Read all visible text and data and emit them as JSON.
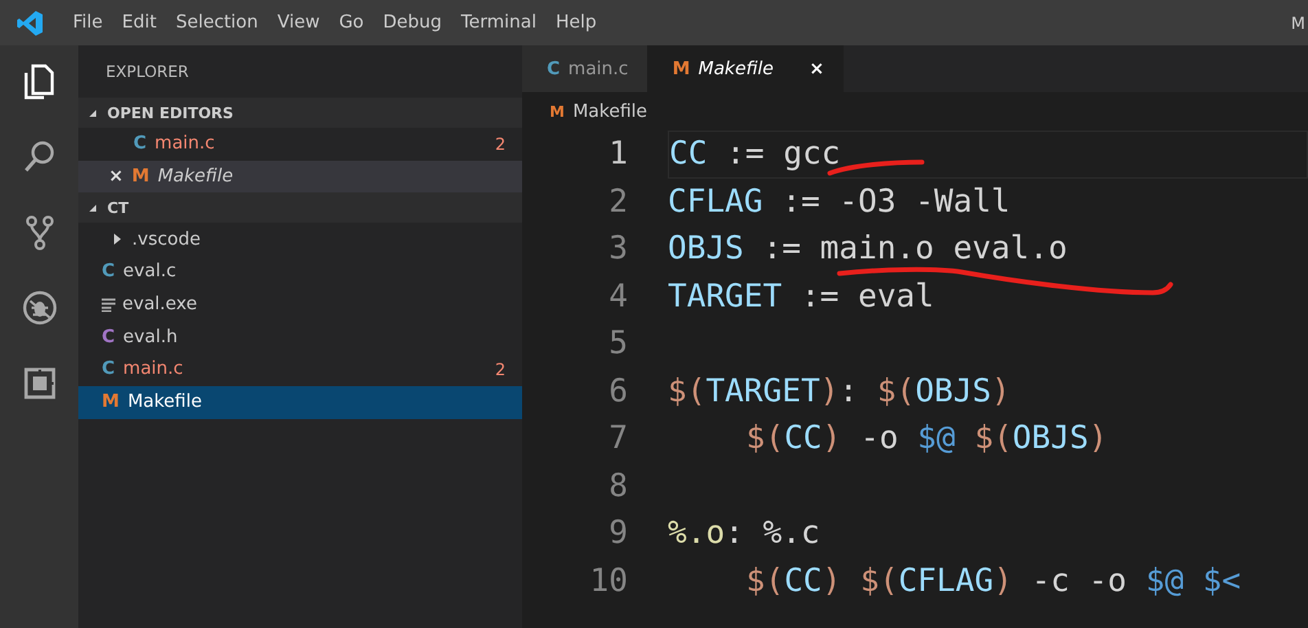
{
  "menu": {
    "items": [
      "File",
      "Edit",
      "Selection",
      "View",
      "Go",
      "Debug",
      "Terminal",
      "Help"
    ],
    "title": "M"
  },
  "activity_bar": {
    "items": [
      {
        "kind": "files",
        "selected": true
      },
      {
        "kind": "search",
        "selected": false
      },
      {
        "kind": "source-control",
        "selected": false
      },
      {
        "kind": "debug",
        "selected": false
      },
      {
        "kind": "extensions",
        "selected": false
      }
    ]
  },
  "sidebar": {
    "title": "EXPLORER",
    "sections": [
      {
        "title": "OPEN EDITORS",
        "expanded": true,
        "items": [
          {
            "kind": "c",
            "icon": "C",
            "name": "main.c",
            "errors": true,
            "badge": "2",
            "preview": false,
            "selected": false
          },
          {
            "kind": "make",
            "icon": "M",
            "name": "Makefile",
            "errors": false,
            "close": "×",
            "preview": true,
            "selected": true
          }
        ]
      },
      {
        "title": "CT",
        "expanded": true,
        "items": [
          {
            "kind": "folder",
            "name": ".vscode",
            "expanded": false,
            "errors": false,
            "selected": false
          },
          {
            "kind": "c",
            "icon": "C",
            "name": "eval.c",
            "errors": false,
            "selected": false
          },
          {
            "kind": "binary",
            "name": "eval.exe",
            "errors": false,
            "selected": false
          },
          {
            "kind": "h",
            "icon": "C",
            "name": "eval.h",
            "errors": false,
            "selected": false
          },
          {
            "kind": "c",
            "icon": "C",
            "name": "main.c",
            "errors": true,
            "badge": "2",
            "selected": false
          },
          {
            "kind": "make",
            "icon": "M",
            "name": "Makefile",
            "errors": false,
            "selected": true
          }
        ]
      }
    ]
  },
  "editor": {
    "tabs": [
      {
        "kind": "c",
        "icon": "C",
        "label": "main.c",
        "preview": false,
        "selected": false
      },
      {
        "kind": "make",
        "icon": "M",
        "label": "Makefile",
        "preview": true,
        "selected": true,
        "close": "×"
      }
    ],
    "breadcrumb": {
      "kind": "make",
      "icon": "M",
      "label": "Makefile"
    },
    "lines": [
      {
        "number": "1",
        "current": true,
        "indented": false,
        "tokens": [
          {
            "kind": "var",
            "text": "CC"
          },
          {
            "kind": "plain",
            "text": " := gcc"
          }
        ]
      },
      {
        "number": "2",
        "current": false,
        "indented": false,
        "tokens": [
          {
            "kind": "var",
            "text": "CFLAG"
          },
          {
            "kind": "plain",
            "text": " := -O3 -Wall"
          }
        ]
      },
      {
        "number": "3",
        "current": false,
        "indented": false,
        "tokens": [
          {
            "kind": "var",
            "text": "OBJS"
          },
          {
            "kind": "plain",
            "text": " := main.o eval.o"
          }
        ]
      },
      {
        "number": "4",
        "current": false,
        "indented": false,
        "tokens": [
          {
            "kind": "var",
            "text": "TARGET"
          },
          {
            "kind": "plain",
            "text": " := eval"
          }
        ]
      },
      {
        "number": "5",
        "current": false
      },
      {
        "number": "6",
        "current": false,
        "indented": false,
        "tokens": [
          {
            "kind": "paren",
            "text": "$("
          },
          {
            "kind": "var",
            "text": "TARGET"
          },
          {
            "kind": "paren",
            "text": ")"
          },
          {
            "kind": "plain",
            "text": ": "
          },
          {
            "kind": "paren",
            "text": "$("
          },
          {
            "kind": "var",
            "text": "OBJS"
          },
          {
            "kind": "paren",
            "text": ")"
          }
        ]
      },
      {
        "number": "7",
        "current": false,
        "indented": true,
        "tokens": [
          {
            "kind": "paren",
            "text": "$("
          },
          {
            "kind": "var",
            "text": "CC"
          },
          {
            "kind": "paren",
            "text": ")"
          },
          {
            "kind": "plain",
            "text": " -o "
          },
          {
            "kind": "auto",
            "text": "$@ "
          },
          {
            "kind": "paren",
            "text": "$("
          },
          {
            "kind": "var",
            "text": "OBJS"
          },
          {
            "kind": "paren",
            "text": ")"
          }
        ]
      },
      {
        "number": "8",
        "current": false
      },
      {
        "number": "9",
        "current": false,
        "indented": false,
        "tokens": [
          {
            "kind": "target",
            "text": "%.o"
          },
          {
            "kind": "plain",
            "text": ": %.c"
          }
        ]
      },
      {
        "number": "10",
        "current": false,
        "indented": true,
        "tokens": [
          {
            "kind": "paren",
            "text": "$("
          },
          {
            "kind": "var",
            "text": "CC"
          },
          {
            "kind": "paren",
            "text": ") "
          },
          {
            "kind": "paren",
            "text": "$("
          },
          {
            "kind": "var",
            "text": "CFLAG"
          },
          {
            "kind": "paren",
            "text": ")"
          },
          {
            "kind": "plain",
            "text": " -c -o "
          },
          {
            "kind": "auto",
            "text": "$@ $<"
          }
        ]
      }
    ]
  }
}
